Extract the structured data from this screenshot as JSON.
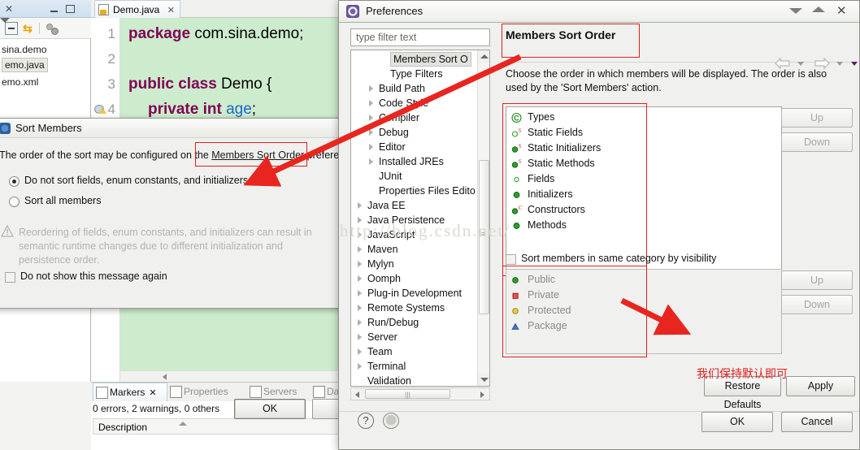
{
  "eclipse": {
    "package_explorer": {
      "items": [
        {
          "label": "sina.demo",
          "selected": false
        },
        {
          "label": "emo.java",
          "selected": true
        },
        {
          "label": "emo.xml",
          "selected": false
        }
      ],
      "toolbar_icons": [
        "collapse-all-icon",
        "link-with-editor-icon",
        "view-menu-icon",
        "dropdown-icon"
      ]
    },
    "editor": {
      "tab_label": "Demo.java",
      "tab_close": "✕",
      "lines": [
        {
          "num": "1",
          "parts": [
            {
              "t": "package ",
              "s": "kw"
            },
            {
              "t": "com.sina.demo;",
              "s": "plain"
            }
          ]
        },
        {
          "num": "2",
          "parts": []
        },
        {
          "num": "3",
          "parts": [
            {
              "t": "public class ",
              "s": "kw"
            },
            {
              "t": "Demo {",
              "s": "plain"
            }
          ]
        },
        {
          "num": "4",
          "parts": [
            {
              "t": "private int ",
              "s": "kw"
            },
            {
              "t": "age",
              "s": "fld"
            },
            {
              "t": ";",
              "s": "plain"
            }
          ]
        }
      ]
    },
    "bottom": {
      "tabs": [
        {
          "label": "Markers",
          "active": true,
          "close": "✕"
        },
        {
          "label": "Properties",
          "active": false
        },
        {
          "label": "Servers",
          "active": false
        },
        {
          "label": "Data S",
          "active": false
        }
      ],
      "summary": "0 errors, 2 warnings, 0 others",
      "column_header": "Description"
    }
  },
  "sort_members_dialog": {
    "title": "Sort Members",
    "description_prefix": "The order of the sort may be configured on the ",
    "description_link": "Members Sort Order",
    "description_suffix": " preference",
    "options": [
      {
        "label": "Do not sort fields, enum constants, and initializers",
        "selected": true
      },
      {
        "label": "Sort all members",
        "selected": false
      }
    ],
    "warning": "Reordering of fields, enum constants, and initializers can result in semantic runtime changes due to different initialization and persistence order.",
    "checkbox": {
      "label": "Do not show this message again",
      "checked": false
    },
    "ok_label": "OK",
    "cancel_label": ""
  },
  "preferences": {
    "title": "Preferences",
    "filter_placeholder": "type filter text",
    "tree": [
      {
        "label": "Members Sort O",
        "indent": 3,
        "arrow": false,
        "selected": true
      },
      {
        "label": "Type Filters",
        "indent": 3,
        "arrow": false,
        "selected": false
      },
      {
        "label": "Build Path",
        "indent": 2,
        "arrow": true,
        "selected": false
      },
      {
        "label": "Code Style",
        "indent": 2,
        "arrow": true,
        "selected": false
      },
      {
        "label": "Compiler",
        "indent": 2,
        "arrow": true,
        "selected": false
      },
      {
        "label": "Debug",
        "indent": 2,
        "arrow": true,
        "selected": false
      },
      {
        "label": "Editor",
        "indent": 2,
        "arrow": true,
        "selected": false
      },
      {
        "label": "Installed JREs",
        "indent": 2,
        "arrow": true,
        "selected": false
      },
      {
        "label": "JUnit",
        "indent": 2,
        "arrow": false,
        "selected": false
      },
      {
        "label": "Properties Files Edito",
        "indent": 2,
        "arrow": false,
        "selected": false
      },
      {
        "label": "Java EE",
        "indent": 1,
        "arrow": true,
        "selected": false
      },
      {
        "label": "Java Persistence",
        "indent": 1,
        "arrow": true,
        "selected": false
      },
      {
        "label": "JavaScript",
        "indent": 1,
        "arrow": true,
        "selected": false
      },
      {
        "label": "Maven",
        "indent": 1,
        "arrow": true,
        "selected": false
      },
      {
        "label": "Mylyn",
        "indent": 1,
        "arrow": true,
        "selected": false
      },
      {
        "label": "Oomph",
        "indent": 1,
        "arrow": true,
        "selected": false
      },
      {
        "label": "Plug-in Development",
        "indent": 1,
        "arrow": true,
        "selected": false
      },
      {
        "label": "Remote Systems",
        "indent": 1,
        "arrow": true,
        "selected": false
      },
      {
        "label": "Run/Debug",
        "indent": 1,
        "arrow": true,
        "selected": false
      },
      {
        "label": "Server",
        "indent": 1,
        "arrow": true,
        "selected": false
      },
      {
        "label": "Team",
        "indent": 1,
        "arrow": true,
        "selected": false
      },
      {
        "label": "Terminal",
        "indent": 1,
        "arrow": true,
        "selected": false
      },
      {
        "label": "Validation",
        "indent": 1,
        "arrow": false,
        "selected": false
      }
    ],
    "page_title": "Members Sort Order",
    "page_description": "Choose the order in which members will be displayed. The order is also used by the 'Sort Members' action.",
    "member_order": [
      {
        "label": "Types",
        "icon": "type-icon"
      },
      {
        "label": "Static Fields",
        "icon": "static-field-icon"
      },
      {
        "label": "Static Initializers",
        "icon": "static-initializer-icon"
      },
      {
        "label": "Static Methods",
        "icon": "static-method-icon"
      },
      {
        "label": "Fields",
        "icon": "field-icon"
      },
      {
        "label": "Initializers",
        "icon": "initializer-icon"
      },
      {
        "label": "Constructors",
        "icon": "constructor-icon"
      },
      {
        "label": "Methods",
        "icon": "method-icon"
      }
    ],
    "visibility_checkbox": {
      "label": "Sort members in same category by visibility",
      "checked": false
    },
    "visibility_order": [
      {
        "label": "Public",
        "icon": "public-icon"
      },
      {
        "label": "Private",
        "icon": "private-icon"
      },
      {
        "label": "Protected",
        "icon": "protected-icon"
      },
      {
        "label": "Package",
        "icon": "package-icon"
      }
    ],
    "up_label": "Up",
    "down_label": "Down",
    "restore_defaults_label": "Restore Defaults",
    "apply_label": "Apply",
    "ok_label": "OK",
    "cancel_label": "Cancel"
  },
  "annotations": {
    "chinese_note": "我们保持默认即可",
    "watermark": "http://blog.csdn.net/"
  },
  "colors": {
    "annotation_red": "#e02020",
    "editor_bg": "#cdeccd",
    "keyword": "#7f0055",
    "field": "#1569c7"
  }
}
